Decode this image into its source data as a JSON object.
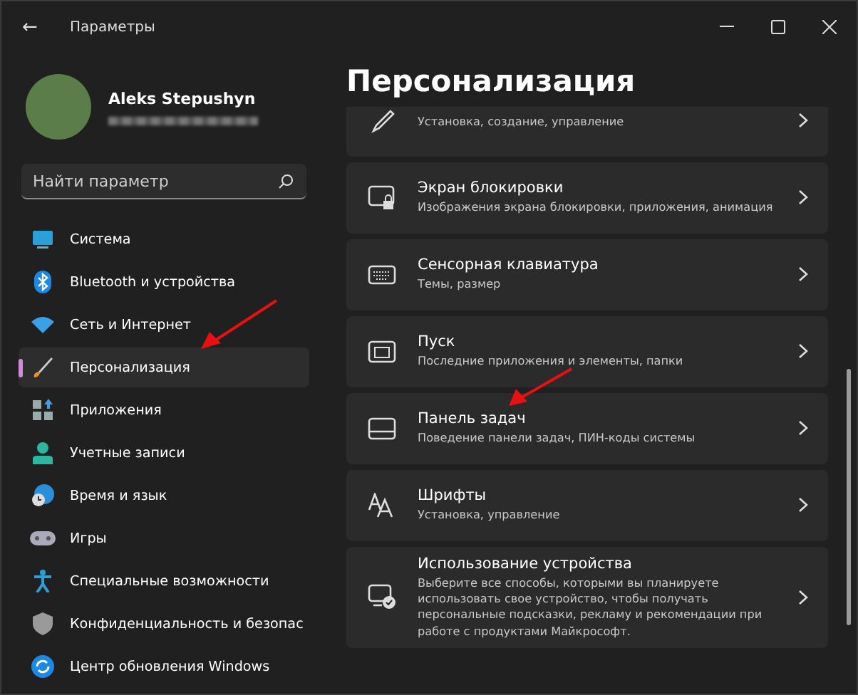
{
  "window": {
    "title": "Параметры",
    "back": "←"
  },
  "profile": {
    "name": "Aleks Stepushyn"
  },
  "search": {
    "placeholder": "Найти параметр"
  },
  "sidebar": {
    "items": [
      {
        "label": "Система",
        "selected": false
      },
      {
        "label": "Bluetooth и устройства",
        "selected": false
      },
      {
        "label": "Сеть и Интернет",
        "selected": false
      },
      {
        "label": "Персонализация",
        "selected": true
      },
      {
        "label": "Приложения",
        "selected": false
      },
      {
        "label": "Учетные записи",
        "selected": false
      },
      {
        "label": "Время и язык",
        "selected": false
      },
      {
        "label": "Игры",
        "selected": false
      },
      {
        "label": "Специальные возможности",
        "selected": false
      },
      {
        "label": "Конфиденциальность и безопас",
        "selected": false
      },
      {
        "label": "Центр обновления Windows",
        "selected": false
      }
    ]
  },
  "page": {
    "title": "Персонализация",
    "cards": [
      {
        "subtitle": "Установка, создание, управление"
      },
      {
        "title": "Экран блокировки",
        "subtitle": "Изображения экрана блокировки, приложения, анимация"
      },
      {
        "title": "Сенсорная клавиатура",
        "subtitle": "Темы, размер"
      },
      {
        "title": "Пуск",
        "subtitle": "Последние приложения и элементы, папки"
      },
      {
        "title": "Панель задач",
        "subtitle": "Поведение панели задач, ПИН-коды системы"
      },
      {
        "title": "Шрифты",
        "subtitle": "Установка, управление"
      },
      {
        "title": "Использование устройства",
        "subtitle": "Выберите все способы, которыми вы планируете использовать свое устройство, чтобы получать персональные подсказки, рекламу и рекомендации при работе с продуктами Майкрософт."
      }
    ]
  }
}
